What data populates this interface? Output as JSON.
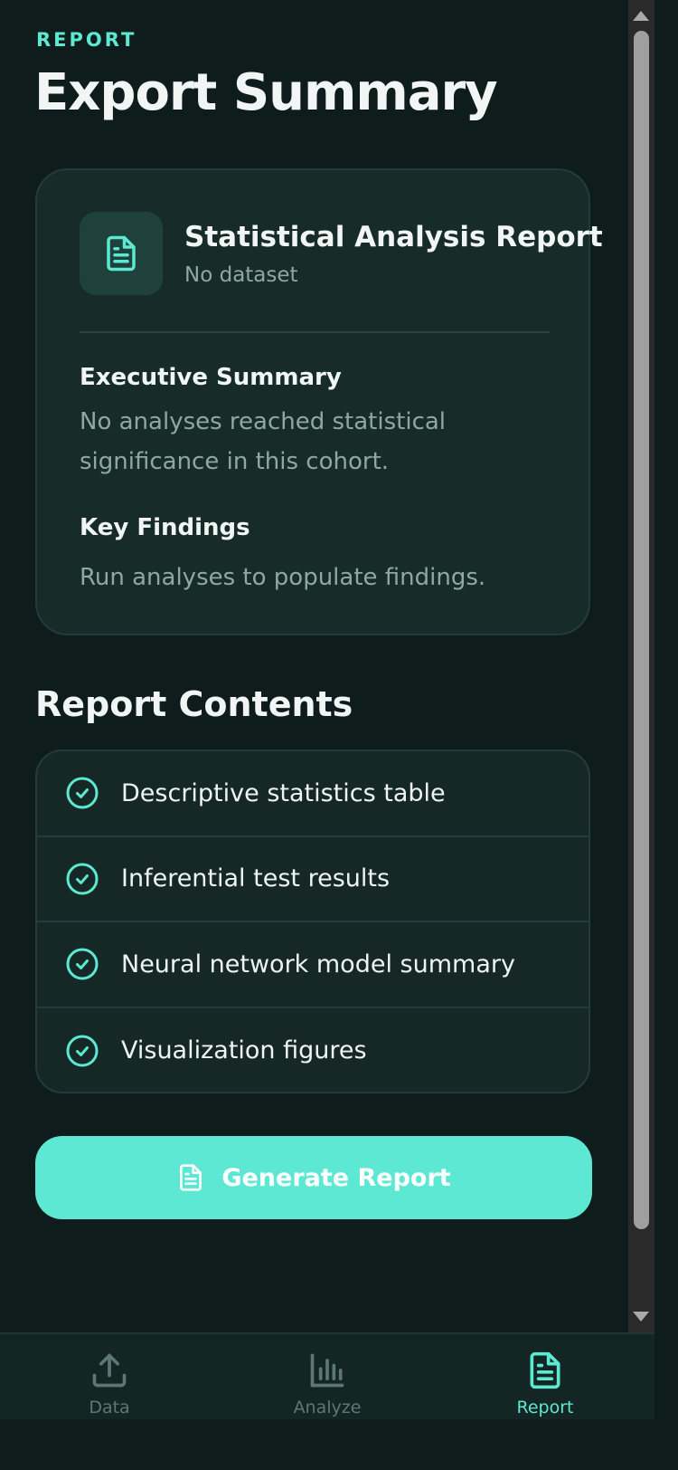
{
  "header": {
    "eyebrow": "REPORT",
    "title": "Export Summary"
  },
  "report_card": {
    "icon": "document-icon",
    "title": "Statistical Analysis Report",
    "subtitle": "No dataset",
    "executive_summary": {
      "heading": "Executive Summary",
      "body": "No analyses reached statistical significance in this cohort."
    },
    "key_findings": {
      "heading": "Key Findings",
      "body": "Run analyses to populate findings."
    }
  },
  "contents": {
    "title": "Report Contents",
    "items": [
      {
        "label": "Descriptive statistics table",
        "icon": "check-circle-icon"
      },
      {
        "label": "Inferential test results",
        "icon": "check-circle-icon"
      },
      {
        "label": "Neural network model summary",
        "icon": "check-circle-icon"
      },
      {
        "label": "Visualization figures",
        "icon": "check-circle-icon"
      }
    ]
  },
  "generate_button": {
    "label": "Generate Report",
    "icon": "document-icon"
  },
  "bottom_nav": {
    "items": [
      {
        "label": "Data",
        "icon": "upload-icon",
        "active": false
      },
      {
        "label": "Analyze",
        "icon": "bar-chart-icon",
        "active": false
      },
      {
        "label": "Report",
        "icon": "document-icon",
        "active": true
      }
    ]
  },
  "colors": {
    "accent": "#5de8d2",
    "background": "#0e1c1b",
    "card": "#172b29",
    "muted_text": "#8ea8a4",
    "button": "#5de8d4"
  }
}
